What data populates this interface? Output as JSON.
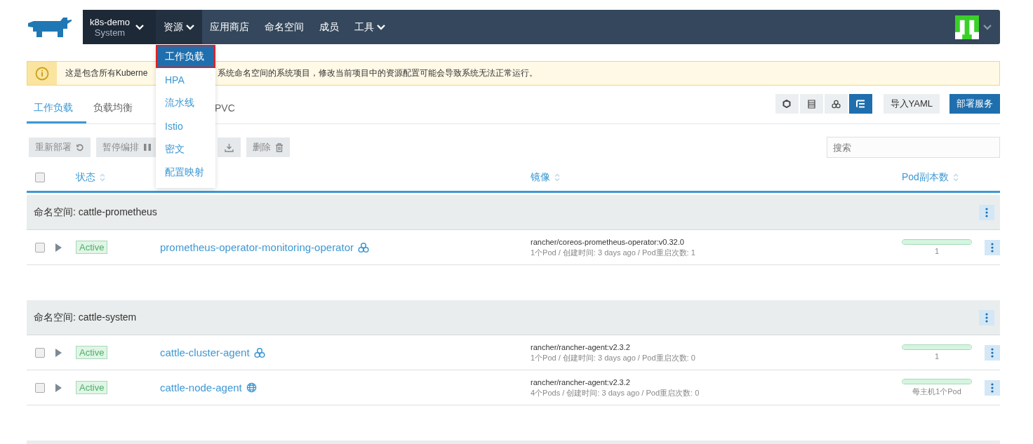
{
  "nav": {
    "project": {
      "name": "k8s-demo",
      "sub": "System"
    },
    "items": [
      {
        "label": "资源",
        "dropdown": true,
        "selected": true
      },
      {
        "label": "应用商店",
        "dropdown": false,
        "selected": false
      },
      {
        "label": "命名空间",
        "dropdown": false,
        "selected": false
      },
      {
        "label": "成员",
        "dropdown": false,
        "selected": false
      },
      {
        "label": "工具",
        "dropdown": true,
        "selected": false
      }
    ]
  },
  "menu": [
    {
      "label": "工作负载",
      "selected": true
    },
    {
      "label": "HPA",
      "selected": false
    },
    {
      "label": "流水线",
      "selected": false
    },
    {
      "label": "Istio",
      "selected": false
    },
    {
      "label": "密文",
      "selected": false
    },
    {
      "label": "配置映射",
      "selected": false
    }
  ],
  "alert": {
    "text_start": "这是包含所有Kuberne",
    "text_end": "系统命名空间的系统项目，修改当前项目中的资源配置可能会导致系统无法正常运行。"
  },
  "tabs": [
    {
      "label": "工作负载",
      "selected": true
    },
    {
      "label": "负载均衡",
      "selected": false
    },
    {
      "label": "PVC",
      "selected": false
    }
  ],
  "view_buttons": [
    {
      "kind": "pod",
      "selected": false
    },
    {
      "kind": "list",
      "selected": false
    },
    {
      "kind": "workload",
      "selected": false
    },
    {
      "kind": "group",
      "selected": true
    }
  ],
  "actions": [
    {
      "label": "导入YAML",
      "kind": "secondary"
    },
    {
      "label": "部署服务",
      "kind": "primary"
    }
  ],
  "bulk_actions": [
    "重新部署",
    "暂停编排",
    "删除"
  ],
  "search": {
    "placeholder": "搜索"
  },
  "select_all": {
    "checked": false
  },
  "columns": [
    {
      "label": "状态",
      "kind": "status"
    },
    {
      "label": "镜像",
      "kind": "image"
    },
    {
      "label": "Pod副本数",
      "kind": "scale"
    }
  ],
  "groups": [
    {
      "label": "命名空间: cattle-prometheus",
      "rows": [
        {
          "checked": false,
          "state": "Active",
          "name": "prometheus-operator-monitoring-operator",
          "kind": "deployment",
          "image": "rancher/coreos-prometheus-operator:v0.32.0",
          "details": "1个Pod / 创建时间: 3 days ago / Pod重启次数: 1",
          "level": 1,
          "scale_label": "1"
        }
      ]
    },
    {
      "label": "命名空间: cattle-system",
      "rows": [
        {
          "checked": false,
          "state": "Active",
          "name": "cattle-cluster-agent",
          "kind": "deployment",
          "image": "rancher/rancher-agent:v2.3.2",
          "details": "1个Pod / 创建时间: 3 days ago / Pod重启次数: 0",
          "level": 1,
          "scale_label": "1"
        },
        {
          "checked": false,
          "state": "Active",
          "name": "cattle-node-agent",
          "kind": "daemonset",
          "image": "rancher/rancher-agent:v2.3.2",
          "details": "4个Pods / 创建时间: 3 days ago / Pod重启次数: 0",
          "level": 1,
          "scale_label": "每主机1个Pod"
        }
      ]
    }
  ]
}
